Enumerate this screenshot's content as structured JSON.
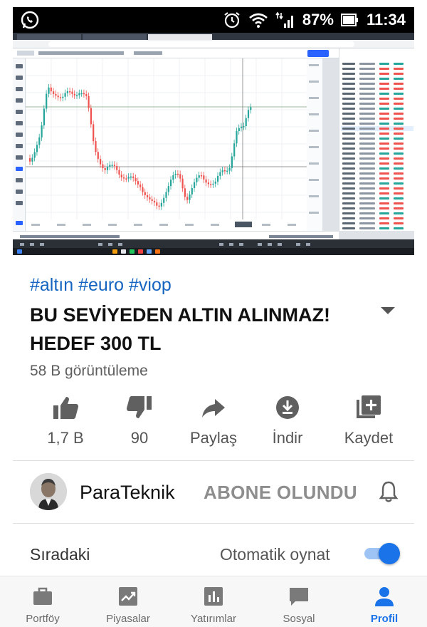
{
  "status_bar": {
    "left_icon": "whatsapp-icon",
    "alarm_icon": "alarm-icon",
    "wifi_icon": "wifi-icon",
    "signal_icon": "signal-icon",
    "battery_percent": "87%",
    "battery_icon": "battery-icon",
    "time": "11:34"
  },
  "video": {
    "description_icon": "tradingview-screenshot"
  },
  "hashtags": "#altın #euro #viop",
  "title": "BU SEVİYEDEN ALTIN ALINMAZ! HEDEF 300 TL",
  "views": "58 B görüntüleme",
  "actions": [
    {
      "icon": "thumbs-up-icon",
      "label": "1,7 B"
    },
    {
      "icon": "thumbs-down-icon",
      "label": "90"
    },
    {
      "icon": "share-icon",
      "label": "Paylaş"
    },
    {
      "icon": "download-icon",
      "label": "İndir"
    },
    {
      "icon": "playlist-add-icon",
      "label": "Kaydet"
    }
  ],
  "channel": {
    "name": "ParaTeknik",
    "subscribe_state": "ABONE OLUNDU",
    "bell_icon": "bell-icon"
  },
  "up_next": {
    "label": "Sıradaki",
    "autoplay_label": "Otomatik oynat",
    "autoplay_on": true
  },
  "bottom_nav": [
    {
      "icon": "briefcase-icon",
      "label": "Portföy",
      "active": false
    },
    {
      "icon": "trend-chart-icon",
      "label": "Piyasalar",
      "active": false
    },
    {
      "icon": "bar-chart-icon",
      "label": "Yatırımlar",
      "active": false
    },
    {
      "icon": "chat-icon",
      "label": "Sosyal",
      "active": false
    },
    {
      "icon": "person-icon",
      "label": "Profil",
      "active": true
    }
  ],
  "colors": {
    "accent": "#1a73e8",
    "hashtag": "#1565c0",
    "candle_up": "#26a69a",
    "candle_down": "#ef5350"
  }
}
